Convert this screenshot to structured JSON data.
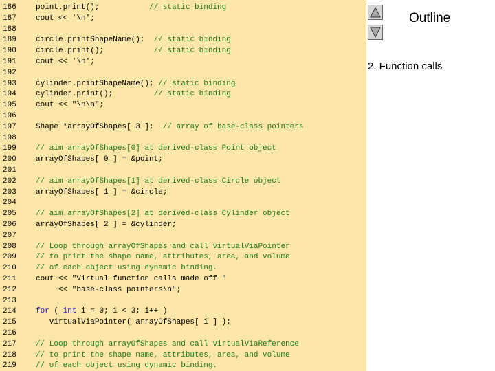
{
  "sidebar": {
    "outline_label": "Outline",
    "section_label": "2. Function calls",
    "up_icon": "triangle-up-icon",
    "down_icon": "triangle-down-icon"
  },
  "code_lines": [
    {
      "n": "186",
      "segs": [
        {
          "t": "point.print();           ",
          "c": "code"
        },
        {
          "t": "// static binding",
          "c": "comment"
        }
      ]
    },
    {
      "n": "187",
      "segs": [
        {
          "t": "cout << '\\n';",
          "c": "code"
        }
      ]
    },
    {
      "n": "188",
      "segs": []
    },
    {
      "n": "189",
      "segs": [
        {
          "t": "circle.printShapeName();  ",
          "c": "code"
        },
        {
          "t": "// static binding",
          "c": "comment"
        }
      ]
    },
    {
      "n": "190",
      "segs": [
        {
          "t": "circle.print();           ",
          "c": "code"
        },
        {
          "t": "// static binding",
          "c": "comment"
        }
      ]
    },
    {
      "n": "191",
      "segs": [
        {
          "t": "cout << '\\n';",
          "c": "code"
        }
      ]
    },
    {
      "n": "192",
      "segs": []
    },
    {
      "n": "193",
      "segs": [
        {
          "t": "cylinder.printShapeName(); ",
          "c": "code"
        },
        {
          "t": "// static binding",
          "c": "comment"
        }
      ]
    },
    {
      "n": "194",
      "segs": [
        {
          "t": "cylinder.print();         ",
          "c": "code"
        },
        {
          "t": "// static binding",
          "c": "comment"
        }
      ]
    },
    {
      "n": "195",
      "segs": [
        {
          "t": "cout << \"\\n\\n\";",
          "c": "code"
        }
      ]
    },
    {
      "n": "196",
      "segs": []
    },
    {
      "n": "197",
      "segs": [
        {
          "t": "Shape *arrayOfShapes[ 3 ];  ",
          "c": "code"
        },
        {
          "t": "// array of base-class pointers",
          "c": "comment"
        }
      ]
    },
    {
      "n": "198",
      "segs": []
    },
    {
      "n": "199",
      "segs": [
        {
          "t": "// aim arrayOfShapes[0] at derived-class Point object",
          "c": "comment"
        }
      ]
    },
    {
      "n": "200",
      "segs": [
        {
          "t": "arrayOfShapes[ 0 ] = &point;",
          "c": "code"
        }
      ]
    },
    {
      "n": "201",
      "segs": []
    },
    {
      "n": "202",
      "segs": [
        {
          "t": "// aim arrayOfShapes[1] at derived-class Circle object",
          "c": "comment"
        }
      ]
    },
    {
      "n": "203",
      "segs": [
        {
          "t": "arrayOfShapes[ 1 ] = &circle;",
          "c": "code"
        }
      ]
    },
    {
      "n": "204",
      "segs": []
    },
    {
      "n": "205",
      "segs": [
        {
          "t": "// aim arrayOfShapes[2] at derived-class Cylinder object",
          "c": "comment"
        }
      ]
    },
    {
      "n": "206",
      "segs": [
        {
          "t": "arrayOfShapes[ 2 ] = &cylinder;",
          "c": "code"
        }
      ]
    },
    {
      "n": "207",
      "segs": []
    },
    {
      "n": "208",
      "segs": [
        {
          "t": "// Loop through arrayOfShapes and call virtualViaPointer",
          "c": "comment"
        }
      ]
    },
    {
      "n": "209",
      "segs": [
        {
          "t": "// to print the shape name, attributes, area, and volume",
          "c": "comment"
        }
      ]
    },
    {
      "n": "210",
      "segs": [
        {
          "t": "// of each object using dynamic binding.",
          "c": "comment"
        }
      ]
    },
    {
      "n": "211",
      "segs": [
        {
          "t": "cout << \"Virtual function calls made off \"",
          "c": "code"
        }
      ]
    },
    {
      "n": "212",
      "segs": [
        {
          "t": "     << \"base-class pointers\\n\";",
          "c": "code"
        }
      ]
    },
    {
      "n": "213",
      "segs": []
    },
    {
      "n": "214",
      "segs": [
        {
          "t": "for",
          "c": "kw"
        },
        {
          "t": " ( ",
          "c": "code"
        },
        {
          "t": "int",
          "c": "kw"
        },
        {
          "t": " i = 0; i < 3; i++ )",
          "c": "code"
        }
      ]
    },
    {
      "n": "215",
      "segs": [
        {
          "t": "   virtualViaPointer( arrayOfShapes[ i ] );",
          "c": "code"
        }
      ]
    },
    {
      "n": "216",
      "segs": []
    },
    {
      "n": "217",
      "segs": [
        {
          "t": "// Loop through arrayOfShapes and call virtualViaReference",
          "c": "comment"
        }
      ]
    },
    {
      "n": "218",
      "segs": [
        {
          "t": "// to print the shape name, attributes, area, and volume",
          "c": "comment"
        }
      ]
    },
    {
      "n": "219",
      "segs": [
        {
          "t": "// of each object using dynamic binding.",
          "c": "comment"
        }
      ]
    }
  ]
}
